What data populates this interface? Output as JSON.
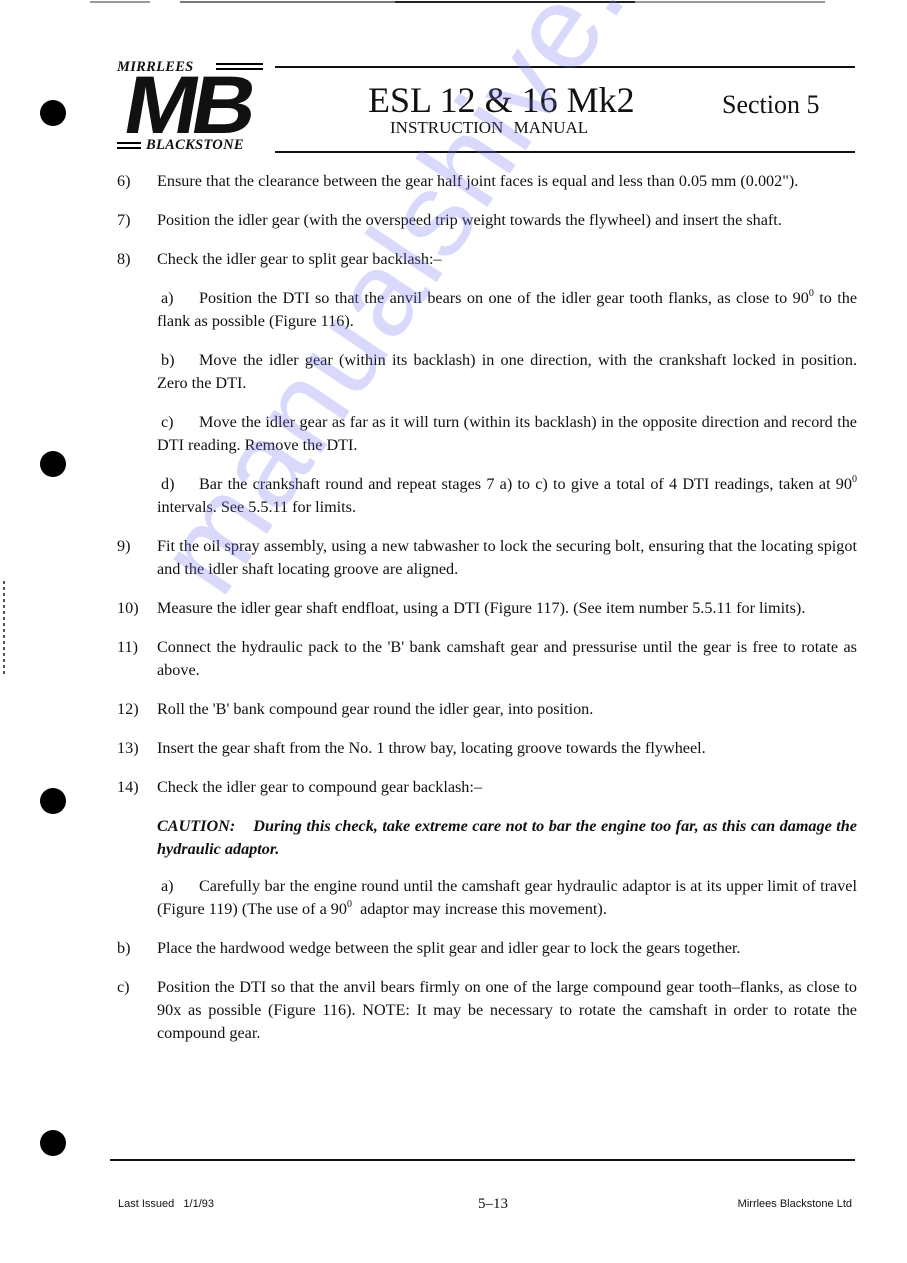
{
  "header": {
    "logo": {
      "top_text": "MIRRLEES",
      "monogram": "MB",
      "bottom_text": "BLACKSTONE"
    },
    "title": "ESL 12 & 16 Mk2",
    "subtitle": "INSTRUCTION MANUAL",
    "section": "Section 5"
  },
  "watermark": "manualshive.com",
  "items": [
    {
      "num": "6)",
      "text": "Ensure that the clearance between the gear half joint faces is equal and less than 0.05 mm (0.002\")."
    },
    {
      "num": "7)",
      "text": "Position the idler gear (with the overspeed trip weight towards the flywheel) and insert the shaft."
    },
    {
      "num": "8)",
      "text": "Check the idler gear to split gear backlash:–"
    }
  ],
  "item8_subs": [
    {
      "letter": "a)",
      "text_before": "Position the DTI so that the anvil bears on one of the idler gear tooth flanks, as close to 90",
      "sup": "0",
      "text_after": " to the flank as possible (Figure 116)."
    },
    {
      "letter": "b)",
      "text_before": "Move the idler gear (within its backlash) in one direction, with the crankshaft locked in position.  Zero the DTI.",
      "sup": "",
      "text_after": ""
    },
    {
      "letter": "c)",
      "text_before": "Move the idler gear as far as it will turn (within its backlash) in the opposite direction and record the DTI reading.  Remove the DTI.",
      "sup": "",
      "text_after": ""
    },
    {
      "letter": "d)",
      "text_before": "Bar the crankshaft round and repeat stages 7 a) to c) to give a total of 4 DTI readings, taken at 90",
      "sup": "0",
      "text_after": " intervals.  See 5.5.11 for limits."
    }
  ],
  "items2": [
    {
      "num": "9)",
      "text": "Fit the oil spray assembly, using a new tabwasher to lock the securing bolt, ensuring that the locating spigot and the idler shaft locating groove are aligned."
    },
    {
      "num": "10)",
      "text": "Measure the idler gear shaft endfloat, using a DTI (Figure 117).  (See item number 5.5.11 for limits)."
    },
    {
      "num": "11)",
      "text": "Connect the hydraulic pack to the 'B' bank camshaft gear and pressurise until the gear is free to rotate as above."
    },
    {
      "num": "12)",
      "text": "Roll the 'B' bank compound gear round the idler gear, into position."
    },
    {
      "num": "13)",
      "text": "Insert the gear shaft from the No. 1 throw bay, locating groove towards the flywheel."
    },
    {
      "num": "14)",
      "text": "Check the idler gear to compound gear backlash:–"
    }
  ],
  "caution": {
    "label": "CAUTION:",
    "text": "During this check, take extreme care not to bar the engine too far, as this can damage the hydraulic adaptor."
  },
  "item14_sub_a": {
    "letter": "a)",
    "text_before": "Carefully bar the engine round until the camshaft gear hydraulic adaptor is at its upper limit of travel (Figure 119) (The use of a 90",
    "sup": "0",
    "text_after": "  adaptor may increase this movement)."
  },
  "items3": [
    {
      "num": "b)",
      "text": "Place the hardwood wedge between the split gear and idler gear to lock  the gears together."
    },
    {
      "num": "c)",
      "text": "Position the DTI so that the anvil bears firmly on one of the large compound gear tooth–flanks, as close to 90x as possible (Figure 116). NOTE: It may be necessary to rotate the camshaft in order to rotate the compound gear."
    }
  ],
  "footer": {
    "last_issued": "Last Issued   1/1/93",
    "page_number": "5–13",
    "company": "Mirrlees Blackstone Ltd"
  }
}
